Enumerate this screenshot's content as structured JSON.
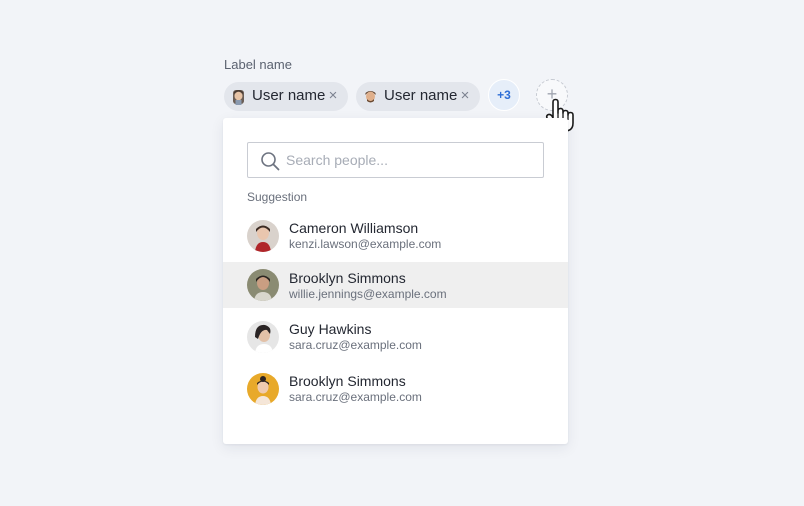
{
  "field": {
    "label": "Label name"
  },
  "chips": [
    {
      "label": "User name",
      "remove_icon": "×",
      "avatar": "user-avatar-1"
    },
    {
      "label": "User name",
      "remove_icon": "×",
      "avatar": "user-avatar-2"
    }
  ],
  "more_badge": "+3",
  "add_button": {
    "icon": "+"
  },
  "search": {
    "placeholder": "Search people...",
    "value": "",
    "icon": "search-icon"
  },
  "suggestion_label": "Suggestion",
  "people": [
    {
      "name": "Cameron Williamson",
      "email": "kenzi.lawson@example.com",
      "active": false
    },
    {
      "name": "Brooklyn Simmons",
      "email": "willie.jennings@example.com",
      "active": true
    },
    {
      "name": "Guy Hawkins",
      "email": "sara.cruz@example.com",
      "active": false
    },
    {
      "name": "Brooklyn Simmons",
      "email": "sara.cruz@example.com",
      "active": false
    }
  ],
  "colors": {
    "background": "#f2f4f8",
    "chip": "#e3e6ec",
    "badge_text": "#2f6fd6",
    "badge_bg": "#e6eef9",
    "hover_row": "#efefef"
  }
}
